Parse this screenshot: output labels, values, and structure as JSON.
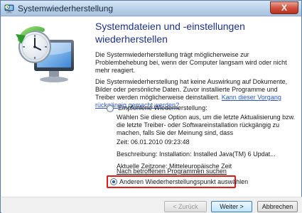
{
  "window": {
    "title": "Systemwiederherstellung",
    "close_symbol": "X"
  },
  "content": {
    "heading": "Systemdateien und -einstellungen wiederherstellen",
    "intro": "Die Systemwiederherstellung trägt möglicherweise zur Problembehebung bei, wenn der Computer langsam wird oder nicht mehr reagiert.",
    "info_text": "Die Systemwiederherstellung hat keine Auswirkung auf Dokumente, Bilder oder persönliche Daten. Zuvor installierte Programme und Treiber werden möglicherweise deinstalliert.",
    "info_link": "Kann dieser Vorgang rückgängig gemacht werden?"
  },
  "options": {
    "recommended": {
      "label": "Empfohlene Wiederherstellung:",
      "selected": false,
      "description": "Wählen Sie diese Option aus, um die letzte Aktualisierung bzw. die letzte Treiber- oder Softwareinstallation rückgängig zu machen, falls Sie der Meinung sind, dass",
      "zeit": "Zeit: 06.01.2010 09:23:48",
      "beschreibung": "Beschreibung: Installation: Installed Java(TM) 6 Updat...",
      "zeitzone": "Aktuelle Zeitzone: Mitteleuropäische Zeit",
      "affected_link": "Nach betroffenen Programmen suchen"
    },
    "other": {
      "label": "Anderen Wiederherstellungspunkt auswählen",
      "selected": true
    }
  },
  "buttons": {
    "back": "< Zurück",
    "next": "Weiter >",
    "cancel": "Abbrechen"
  },
  "icons": {
    "title": "system-restore-icon",
    "illustration": "restore-clock-monitor-icon"
  },
  "colors": {
    "heading": "#1e3287",
    "link": "#2a55c4",
    "highlight": "#e21a1a"
  }
}
